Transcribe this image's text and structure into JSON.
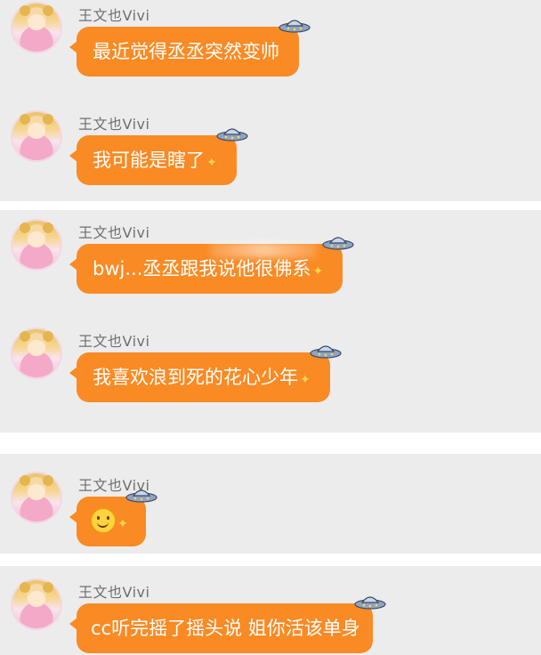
{
  "colors": {
    "background": "#ececec",
    "bubble": "#fa8a24",
    "bubble_text": "#ffffff",
    "name_text": "#6f6f6f"
  },
  "messages": [
    {
      "sender": "王文也Vivi",
      "text": "最近觉得丞丞突然变帅"
    },
    {
      "sender": "王文也Vivi",
      "text": "我可能是瞎了"
    },
    {
      "sender": "王文也Vivi",
      "text": "bwj...丞丞跟我说他很佛系"
    },
    {
      "sender": "王文也Vivi",
      "text": "我喜欢浪到死的花心少年"
    },
    {
      "sender": "王文也Vivi",
      "text": "",
      "emoji": "smiley-icon"
    },
    {
      "sender": "王文也Vivi",
      "text": "cc听完摇了摇头说 姐你活该单身"
    }
  ],
  "icons": {
    "avatar": "girl-avatar",
    "decoration": "ufo-icon",
    "sparkle": "sparkle-icon"
  }
}
